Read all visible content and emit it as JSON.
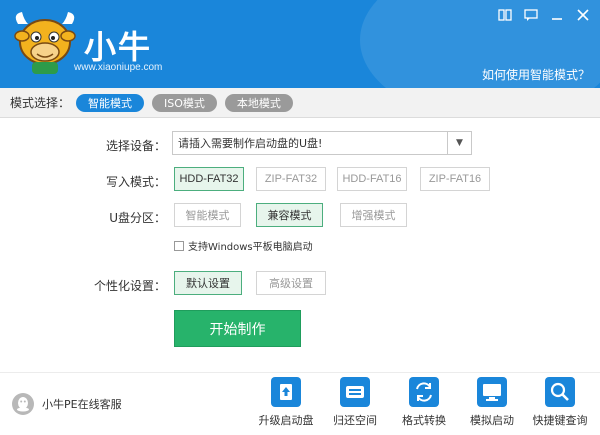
{
  "header": {
    "title": "小牛",
    "url": "www.xiaoniupe.com",
    "help_link": "如何使用智能模式？"
  },
  "modes": {
    "label": "模式选择：",
    "items": [
      {
        "label": "智能模式",
        "active": true
      },
      {
        "label": "ISO模式",
        "active": false
      },
      {
        "label": "本地模式",
        "active": false
      }
    ]
  },
  "form": {
    "device": {
      "label": "选择设备：",
      "value": "请插入需要制作启动盘的U盘!"
    },
    "write_mode": {
      "label": "写入模式：",
      "options": [
        "HDD-FAT32",
        "ZIP-FAT32",
        "HDD-FAT16",
        "ZIP-FAT16"
      ],
      "selected": "HDD-FAT32"
    },
    "partition": {
      "label": "U盘分区：",
      "options": [
        "智能模式",
        "兼容模式",
        "增强模式"
      ],
      "selected": "兼容模式"
    },
    "tablet_checkbox": {
      "label": "支持Windows平板电脑启动",
      "checked": false
    },
    "personalize": {
      "label": "个性化设置：",
      "options": [
        "默认设置",
        "高级设置"
      ],
      "selected": "默认设置"
    },
    "start_button": "开始制作"
  },
  "footer": {
    "support": "小牛PE在线客服",
    "tools": [
      {
        "label": "升级启动盘",
        "icon": "upgrade-disk-icon"
      },
      {
        "label": "归还空间",
        "icon": "disk-space-icon"
      },
      {
        "label": "格式转换",
        "icon": "format-convert-icon"
      },
      {
        "label": "模拟启动",
        "icon": "monitor-icon"
      },
      {
        "label": "快捷键查询",
        "icon": "search-icon"
      }
    ]
  },
  "colors": {
    "primary": "#1a86da",
    "accent_green": "#27b36b",
    "selected_border": "#4cae7e"
  }
}
